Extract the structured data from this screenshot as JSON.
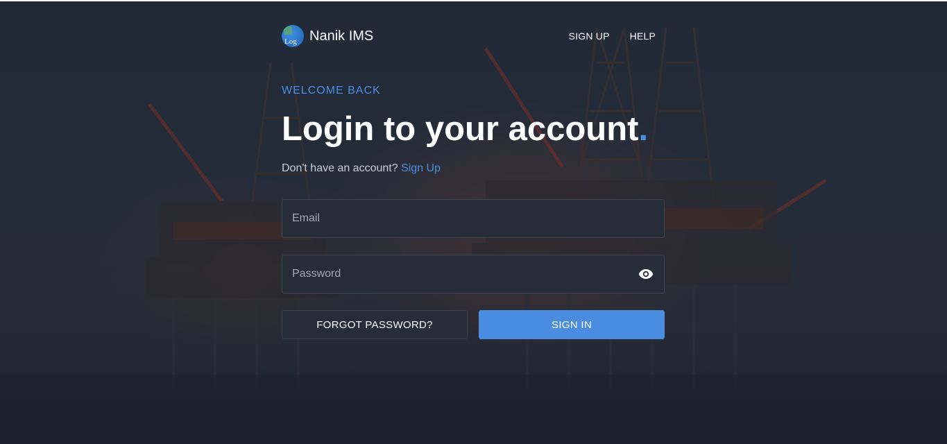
{
  "app": {
    "name": "Nanik IMS",
    "logo_alt": "Log"
  },
  "nav": {
    "signup": "SIGN UP",
    "help": "HELP"
  },
  "login": {
    "eyebrow": "WELCOME BACK",
    "title": "Login to your account",
    "title_dot": ".",
    "prompt": "Don't have an account?",
    "signup_link": "Sign Up"
  },
  "form": {
    "email_placeholder": "Email",
    "email_value": "",
    "password_placeholder": "Password",
    "password_value": "",
    "toggle_icon": "eye-icon"
  },
  "buttons": {
    "forgot": "FORGOT PASSWORD?",
    "signin": "SIGN IN"
  },
  "colors": {
    "accent": "#4a90e2",
    "background": "#232a37",
    "field": "#262c38"
  }
}
